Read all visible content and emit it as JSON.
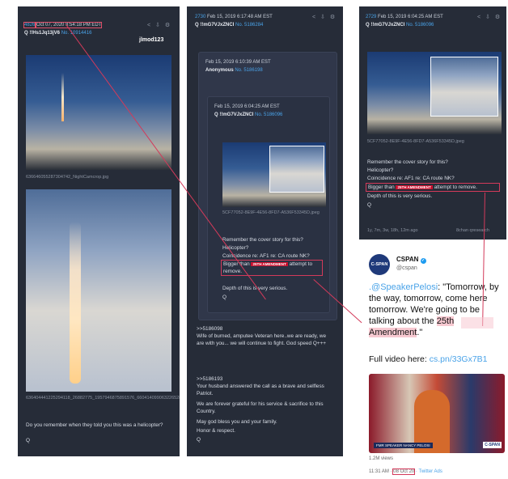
{
  "left_post": {
    "num": "4826",
    "date": "Oct 07, 2020 8:54:18 PM EDT",
    "id": "Q !!Hs1Jq13jV6",
    "post_no": "No. 10914416",
    "user": "jlmod123",
    "img1_file": "636646055287304742_NightCamcrop.jpg",
    "img2_file": "636404441225294118_26882775_1957946875891576_66041409906322652888_n.jpg",
    "text1": "Do you remember when they told you this was a helicopter?",
    "text2": "Q",
    "icons": "< ⇩ ⚙"
  },
  "mid_post": {
    "num": "2730",
    "date": "Feb 15, 2019 6:17:48 AM EST",
    "id": "Q !!mG7VJxZNCI",
    "post_no": "No. 5186284",
    "icons": "< ⇩ ⚙",
    "quote_date": "Feb 15, 2019 6:10:39 AM EST",
    "quote_name": "Anonymous",
    "quote_no": "No. 5186198",
    "inner_date": "Feb 15, 2019 6:04:25 AM EST",
    "inner_id": "Q !!mG7VJxZNCI",
    "inner_no": "No. 5186096",
    "inner_file": "5CF77052-8E9F-4E56-8FD7-A536F53345D.jpeg",
    "l1": "Remember the cover story for this?",
    "l2": "Helicopter?",
    "l3": "Coincidence re: AF1 re: CA route NK?",
    "bigger": "Bigger than",
    "tag": "25TH AMENDMENT",
    "attempt": "attempt to remove.",
    "depth": "Depth of this is very serious.",
    "q": "Q",
    "reply1_ref": ">>5186098",
    "reply1": "Wife of burned, amputee Veteran here..we are ready, we are with you... we will continue to fight. God speed Q+++",
    "reply2_ref": ">>5186193",
    "reply2a": "Your husband answered the call as a brave and selfless Patriot.",
    "reply2b": "We are forever grateful for his service & sacrifice to this Country.",
    "reply2c": "May god bless you and your family.",
    "reply2d": "Honor & respect.",
    "reply2e": "Q"
  },
  "right_post": {
    "num": "2729",
    "date": "Feb 15, 2019 6:04:25 AM EST",
    "id": "Q !!mG7VJxZNCI",
    "post_no": "No. 5186096",
    "icons": "< ⇩ ⚙",
    "file": "5CF77052-8E9F-4E56-8FD7-A536F53345D.jpeg",
    "l1": "Remember the cover story for this?",
    "l2": "Helicopter?",
    "l3": "Coincidence re: AF1 re: CA route NK?",
    "bigger": "Bigger than",
    "tag": "25TH AMENDMENT",
    "attempt": "attempt to remove.",
    "depth": "Depth of this is very serious.",
    "q": "Q",
    "footer_left": "1y, 7m, 3w, 18h, 12m ago",
    "footer_right": "8chan qresearch"
  },
  "tweet": {
    "avatar": "C-SPAN",
    "name": "CSPAN",
    "handle": "@cspan",
    "mention": ".@SpeakerPelosi",
    "body1": ": \"Tomorrow, by the way, tomorrow, come here tomorrow. We're going to be talking about the ",
    "highlight": "25th Amendment",
    "body2": ".\"",
    "full_video": "Full video here: ",
    "link": "cs.pn/33Gx7B1",
    "caption": "FMR SPEAKER NANCY PELOSI",
    "logo": "C-SPAN",
    "views": "1.2M views",
    "time": "11:31 AM · ",
    "date": "08 Oct 20",
    "source": " · Twitter Ads"
  },
  "colors": {
    "panel": "#262c38",
    "link_blue": "#4aa3e8",
    "highlight_red": "#d33a5a",
    "pink": "#f7c9d1"
  }
}
